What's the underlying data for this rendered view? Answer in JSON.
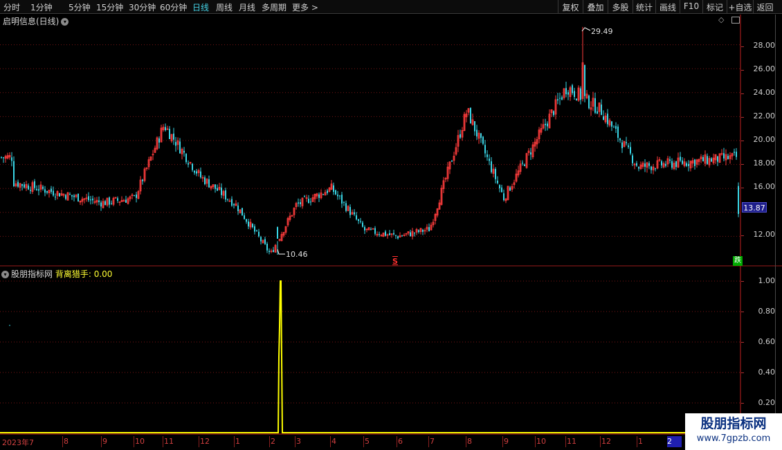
{
  "toolbar": {
    "periods": [
      "分时",
      "1分钟",
      "5分钟",
      "15分钟",
      "30分钟",
      "60分钟",
      "日线",
      "周线",
      "月线",
      "多周期",
      "更多 >"
    ],
    "active_period": "日线",
    "actions": [
      "复权",
      "叠加",
      "多股",
      "统计",
      "画线",
      "F10",
      "标记",
      "+自选",
      "返回"
    ]
  },
  "main_chart": {
    "title": "启明信息(日线)",
    "y_labels": [
      "28.00",
      "26.00",
      "24.00",
      "22.00",
      "20.00",
      "18.00",
      "16.00",
      "12.00"
    ],
    "high_label": "29.49",
    "low_label": "10.46",
    "current_price": "13.87",
    "signal_s": "S",
    "fall_badge": "跌"
  },
  "indicator": {
    "source": "股朋指标网",
    "name": "背离猎手",
    "value_text": "0.00",
    "y_labels": [
      "1.00",
      "0.80",
      "0.60",
      "0.40",
      "0.20"
    ]
  },
  "x_axis": {
    "labels": [
      "2023年7",
      "8",
      "9",
      "10",
      "11",
      "12",
      "1",
      "2",
      "3",
      "4",
      "5",
      "6",
      "7",
      "8",
      "9",
      "10",
      "11",
      "12",
      "1",
      "2"
    ]
  },
  "watermark": {
    "title": "股朋指标网",
    "url": "www.7gpzb.com"
  },
  "colors": {
    "up": "#ff3c3c",
    "down": "#39d6e6",
    "indicator_line": "#ffff00",
    "grid": "#7a1515",
    "axis": "#c02020"
  },
  "chart_data": [
    {
      "type": "candlestick",
      "title": "启明信息(日线)",
      "ylim": [
        10,
        30
      ],
      "x": [
        "2023年7",
        "8",
        "9",
        "10",
        "11",
        "12",
        "1",
        "2",
        "3",
        "4",
        "5",
        "6",
        "7",
        "8",
        "9",
        "10",
        "11",
        "12",
        "1",
        "2"
      ],
      "key_values": {
        "high": 29.49,
        "low": 10.46,
        "current": 13.87
      },
      "close_path": [
        [
          "2023年7",
          16.5
        ],
        [
          "8",
          15.5
        ],
        [
          "9",
          14.8
        ],
        [
          "10",
          15.2
        ],
        [
          "11",
          21.3
        ],
        [
          "12",
          17.0
        ],
        [
          "1",
          14.7
        ],
        [
          "2",
          10.5
        ],
        [
          "3",
          14.6
        ],
        [
          "4",
          16.0
        ],
        [
          "5",
          12.5
        ],
        [
          "6",
          12.0
        ],
        [
          "7",
          12.6
        ],
        [
          "8",
          22.5
        ],
        [
          "9",
          15.2
        ],
        [
          "10",
          20.0
        ],
        [
          "11",
          24.5
        ],
        [
          "12",
          22.5
        ],
        [
          "1",
          17.8
        ],
        [
          "2",
          18.6
        ]
      ]
    },
    {
      "type": "line",
      "title": "背离猎手",
      "ylim": [
        0,
        1
      ],
      "series": [
        {
          "name": "背离猎手",
          "color": "#ffff00",
          "note_points": [
            [
              "2",
              1.0
            ]
          ]
        }
      ],
      "current_value": 0.0
    }
  ]
}
